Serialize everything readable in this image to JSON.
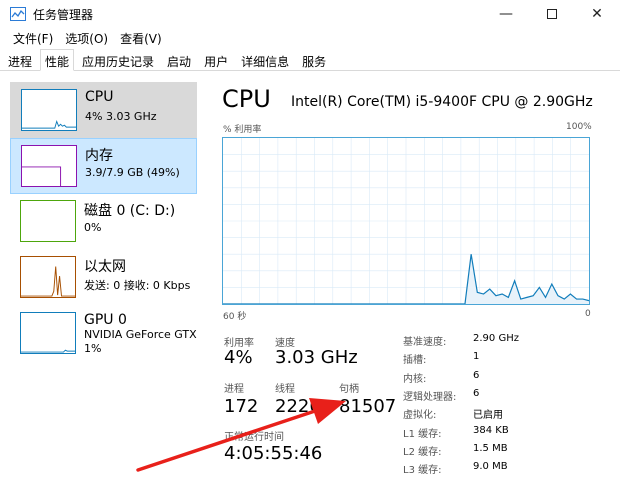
{
  "window": {
    "title": "任务管理器"
  },
  "menu": {
    "items": [
      "文件(F)",
      "选项(O)",
      "查看(V)"
    ]
  },
  "tabs": [
    "进程",
    "性能",
    "应用历史记录",
    "启动",
    "用户",
    "详细信息",
    "服务"
  ],
  "active_tab": "性能",
  "devices": [
    {
      "name": "CPU",
      "sub": "4% 3.03 GHz",
      "sub2": ""
    },
    {
      "name": "内存",
      "sub": "3.9/7.9 GB (49%)",
      "sub2": ""
    },
    {
      "name": "磁盘 0 (C: D:)",
      "sub": "0%",
      "sub2": ""
    },
    {
      "name": "以太网",
      "sub": "发送: 0 接收: 0 Kbps",
      "sub2": ""
    },
    {
      "name": "GPU 0",
      "sub": "NVIDIA GeForce GTX",
      "sub2": "1%"
    }
  ],
  "cpu": {
    "title": "CPU",
    "model": "Intel(R) Core(TM) i5-9400F CPU @ 2.90GHz",
    "graph_label_left": "% 利用率",
    "graph_label_right": "100%",
    "graph_bottom_left": "60 秒",
    "graph_bottom_right": "0",
    "utilization_percent_series": [
      0,
      0,
      0,
      0,
      0,
      0,
      0,
      0,
      0,
      0,
      0,
      0,
      0,
      0,
      0,
      0,
      0,
      0,
      0,
      0,
      0,
      0,
      0,
      0,
      0,
      0,
      0,
      0,
      0,
      0,
      0,
      0,
      0,
      0,
      0,
      0,
      0,
      0,
      0,
      0,
      30,
      7,
      6,
      9,
      5,
      6,
      4,
      14,
      3,
      4,
      5,
      10,
      4,
      12,
      5,
      3,
      6,
      3,
      3,
      2
    ]
  },
  "stats": {
    "util_label": "利用率",
    "util_value": "4%",
    "speed_label": "速度",
    "speed_value": "3.03 GHz",
    "proc_label": "进程",
    "proc_value": "172",
    "thread_label": "线程",
    "thread_value": "2226",
    "handle_label": "句柄",
    "handle_value": "81507",
    "uptime_label": "正常运行时间",
    "uptime_value": "4:05:55:46"
  },
  "specs": [
    {
      "label": "基准速度:",
      "value": "2.90 GHz"
    },
    {
      "label": "插槽:",
      "value": "1"
    },
    {
      "label": "内核:",
      "value": "6"
    },
    {
      "label": "逻辑处理器:",
      "value": "6"
    },
    {
      "label": "虚拟化:",
      "value": "已启用"
    },
    {
      "label": "L1 缓存:",
      "value": "384 KB"
    },
    {
      "label": "L2 缓存:",
      "value": "1.5 MB"
    },
    {
      "label": "L3 缓存:",
      "value": "9.0 MB"
    }
  ],
  "colors": {
    "cpu_line": "#117dbb",
    "cpu_border": "#4aa5d6",
    "mem_line": "#8b12ae",
    "disk_line": "#4da60c",
    "eth_line": "#a74f01",
    "gpu_line": "#117dbb",
    "arrow": "#e8201a"
  }
}
